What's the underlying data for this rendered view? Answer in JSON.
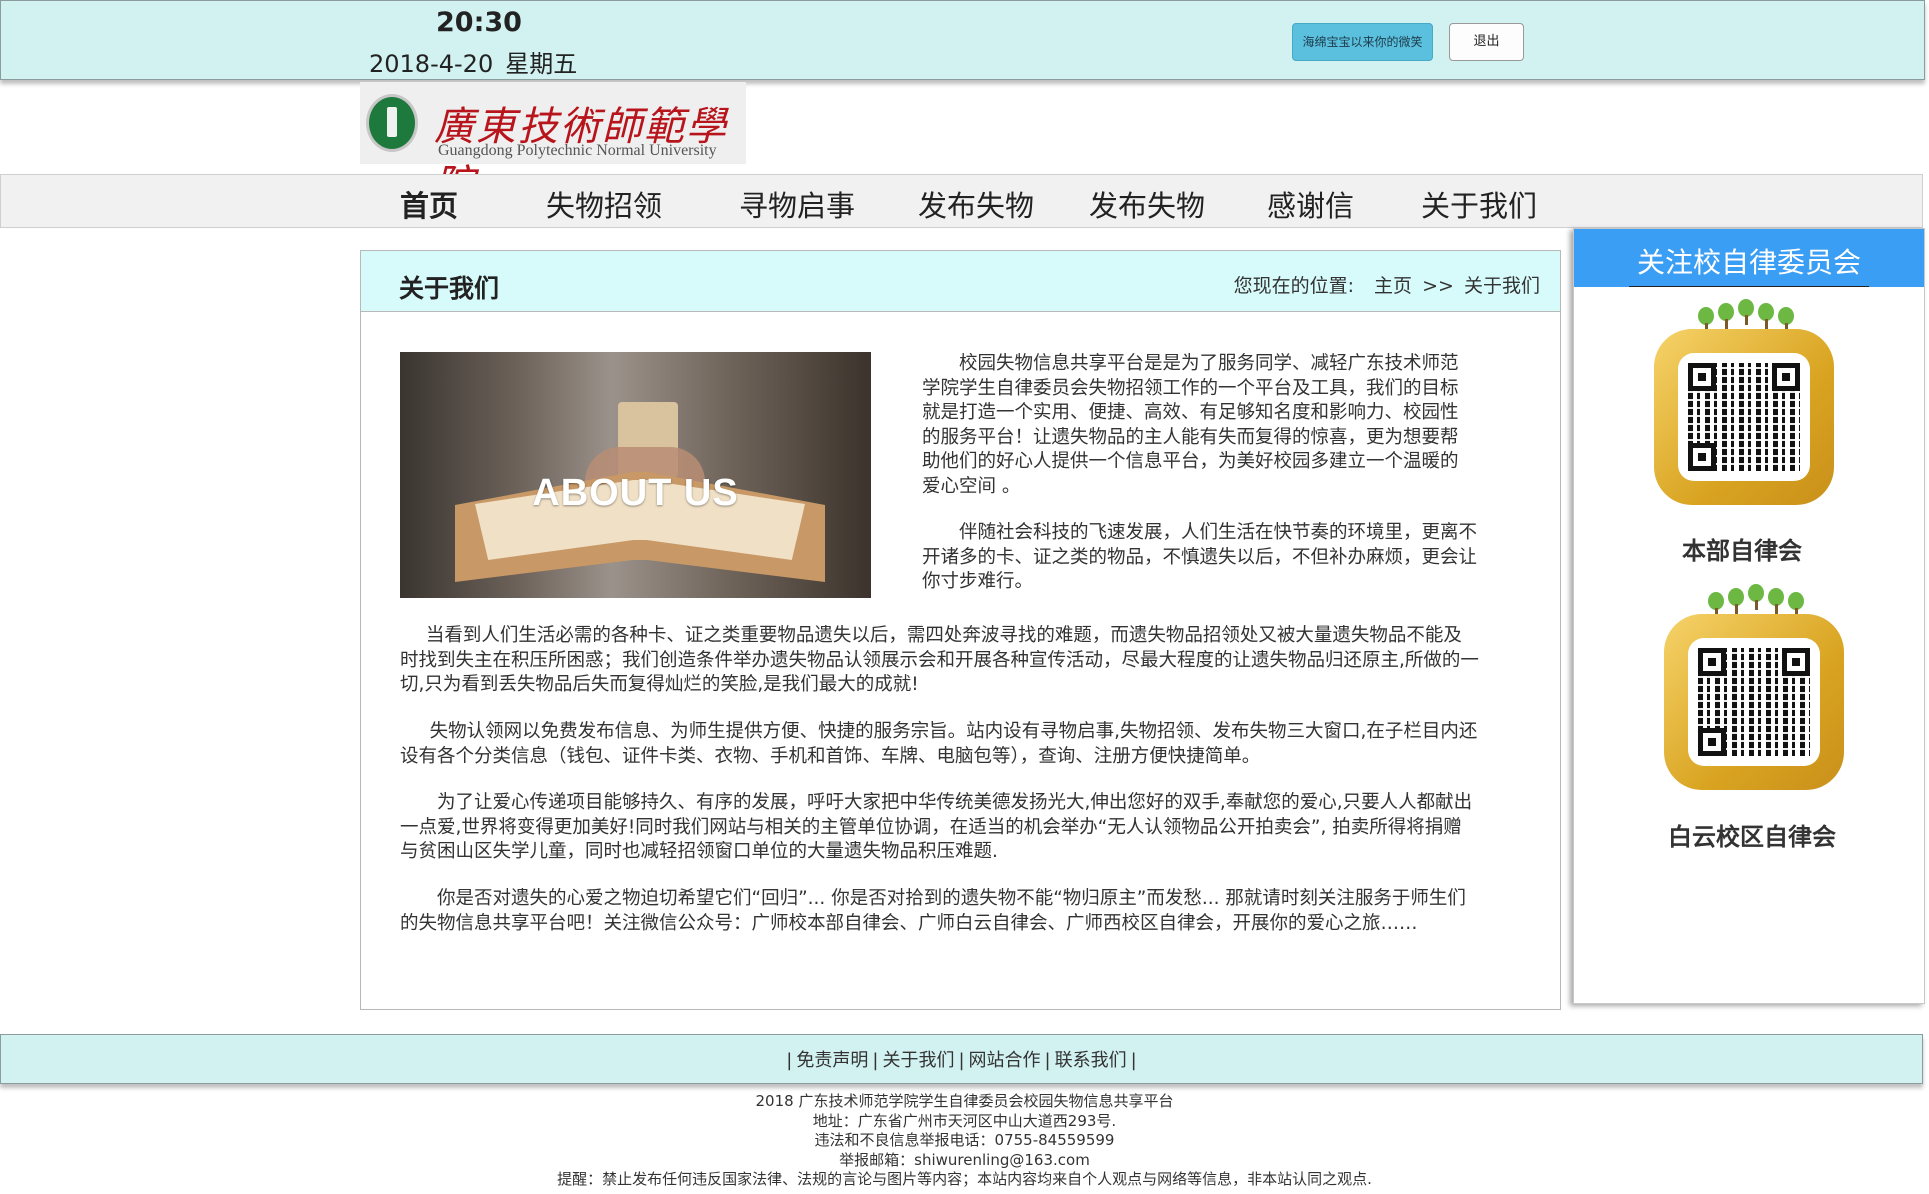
{
  "header": {
    "time": "20:30",
    "date": "2018-4-20",
    "weekday": "星期五",
    "user_button": "海绵宝宝以来你的微笑",
    "logout_button": "退出"
  },
  "logo": {
    "chinese": "廣東技術師範學院",
    "english": "Guangdong Polytechnic Normal University"
  },
  "nav": {
    "items": [
      "首页",
      "失物招领",
      "寻物启事",
      "发布失物",
      "发布失物",
      "感谢信",
      "关于我们"
    ]
  },
  "main": {
    "title": "关于我们",
    "breadcrumb": {
      "prefix": "您现在的位置:",
      "home": "主页",
      "separator": ">>",
      "current": "关于我们"
    },
    "image_text": "ABOUT US",
    "paragraphs": [
      "校园失物信息共享平台是是为了服务同学、减轻广东技术师范学院学生自律委员会失物招领工作的一个平台及工具，我们的目标就是打造一个实用、便捷、高效、有足够知名度和影响力、校园性的服务平台！让遗失物品的主人能有失而复得的惊喜，更为想要帮助他们的好心人提供一个信息平台，为美好校园多建立一个温暖的爱心空间 。",
      "伴随社会科技的飞速发展，人们生活在快节奏的环境里，更离不开诸多的卡、证之类的物品，不慎遗失以后，不但补办麻烦，更会让你寸步难行。",
      "当看到人们生活必需的各种卡、证之类重要物品遗失以后，需四处奔波寻找的难题，而遗失物品招领处又被大量遗失物品不能及时找到失主在积压所困惑；我们创造条件举办遗失物品认领展示会和开展各种宣传活动，尽最大程度的让遗失物品归还原主,所做的一切,只为看到丢失物品后失而复得灿烂的笑脸,是我们最大的成就!",
      "失物认领网以免费发布信息、为师生提供方便、快捷的服务宗旨。站内设有寻物启事,失物招领、发布失物三大窗口,在子栏目内还设有各个分类信息（钱包、证件卡类、衣物、手机和首饰、车牌、电脑包等），查询、注册方便快捷简单。",
      "为了让爱心传递项目能够持久、有序的发展，呼吁大家把中华传统美德发扬光大,伸出您好的双手,奉献您的爱心,只要人人都献出一点爱,世界将变得更加美好!同时我们网站与相关的主管单位协调，在适当的机会举办“无人认领物品公开拍卖会”, 拍卖所得将捐赠与贫困山区失学儿童，同时也减轻招领窗口单位的大量遗失物品积压难题.",
      "你是否对遗失的心爱之物迫切希望它们“回归”... 你是否对拾到的遗失物不能“物归原主”而发愁... 那就请时刻关注服务于师生们的失物信息共享平台吧！关注微信公众号：广师校本部自律会、广师白云自律会、广师西校区自律会，开展你的爱心之旅……"
    ]
  },
  "sidebar": {
    "title": "关注校自律委员会",
    "qr_codes": [
      {
        "label": "本部自律会"
      },
      {
        "label": "白云校区自律会"
      }
    ]
  },
  "footer": {
    "links": [
      "免责声明",
      "关于我们",
      "网站合作",
      "联系我们"
    ],
    "separator": "|",
    "info_lines": [
      "2018 广东技术师范学院学生自律委员会校园失物信息共享平台",
      "地址：广东省广州市天河区中山大道西293号.",
      "违法和不良信息举报电话：0755-84559599",
      "举报邮箱：shiwurenling@163.com",
      "提醒：禁止发布任何违反国家法律、法规的言论与图片等内容；本站内容均来自个人观点与网络等信息，非本站认同之观点."
    ]
  },
  "colors": {
    "top_bar": "#d2f1f1",
    "panel_header": "#d7fafa",
    "sidebar_header": "#3b9ef5",
    "user_button": "#5bc0de",
    "logo_text": "#b8141b"
  }
}
